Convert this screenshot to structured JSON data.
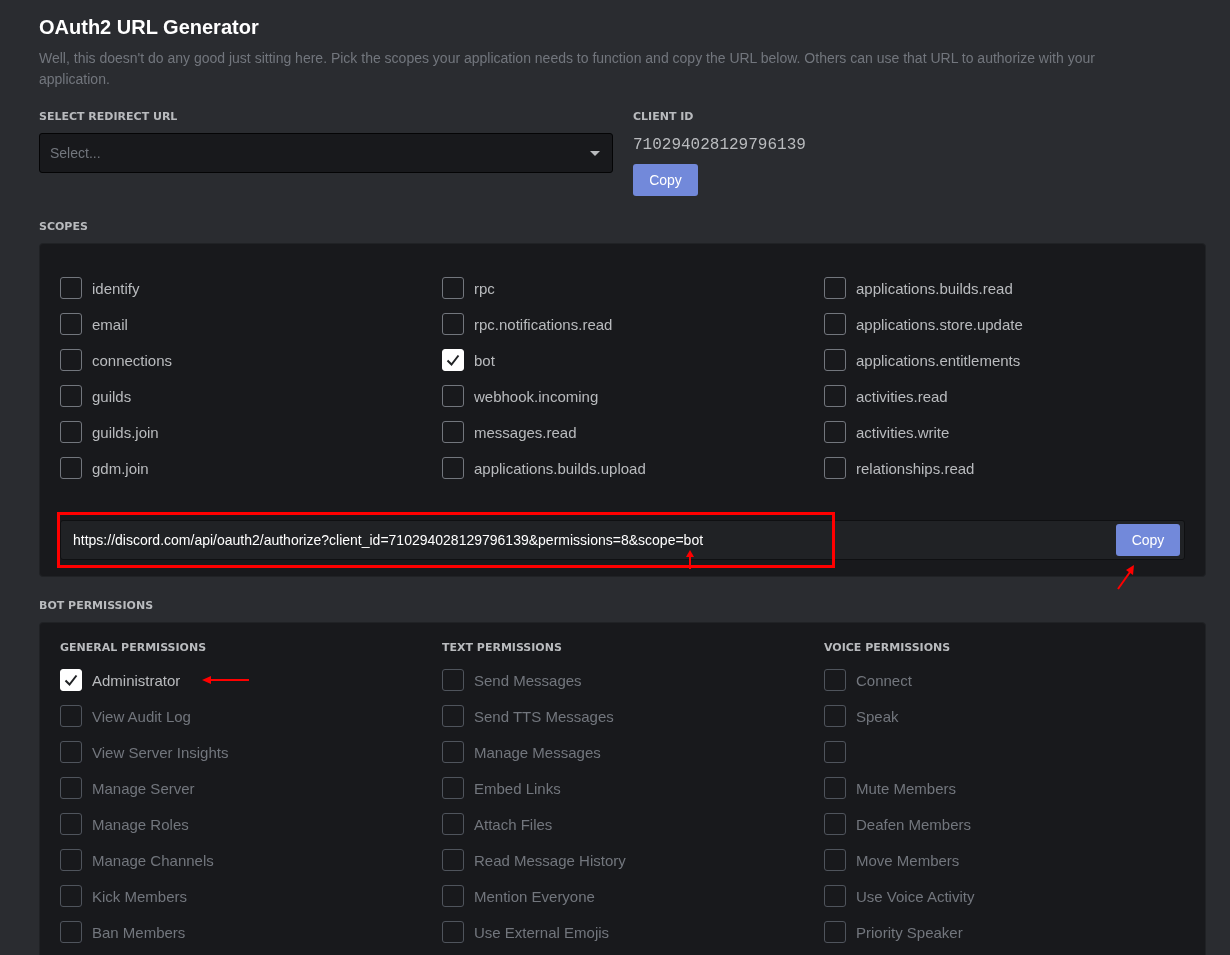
{
  "title": "OAuth2 URL Generator",
  "description": "Well, this doesn't do any good just sitting here. Pick the scopes your application needs to function and copy the URL below. Others can use that URL to authorize with your application.",
  "redirect": {
    "label": "SELECT REDIRECT URL",
    "placeholder": "Select..."
  },
  "client_id": {
    "label": "CLIENT ID",
    "value": "710294028129796139",
    "button": "Copy"
  },
  "scopes": {
    "label": "SCOPES",
    "items": [
      {
        "label": "identify",
        "checked": false
      },
      {
        "label": "rpc",
        "checked": false
      },
      {
        "label": "applications.builds.read",
        "checked": false
      },
      {
        "label": "email",
        "checked": false
      },
      {
        "label": "rpc.notifications.read",
        "checked": false
      },
      {
        "label": "applications.store.update",
        "checked": false
      },
      {
        "label": "connections",
        "checked": false
      },
      {
        "label": "bot",
        "checked": true
      },
      {
        "label": "applications.entitlements",
        "checked": false
      },
      {
        "label": "guilds",
        "checked": false
      },
      {
        "label": "webhook.incoming",
        "checked": false
      },
      {
        "label": "activities.read",
        "checked": false
      },
      {
        "label": "guilds.join",
        "checked": false
      },
      {
        "label": "messages.read",
        "checked": false
      },
      {
        "label": "activities.write",
        "checked": false
      },
      {
        "label": "gdm.join",
        "checked": false
      },
      {
        "label": "applications.builds.upload",
        "checked": false
      },
      {
        "label": "relationships.read",
        "checked": false
      }
    ],
    "url": "https://discord.com/api/oauth2/authorize?client_id=710294028129796139&permissions=8&scope=bot",
    "button": "Copy"
  },
  "bot_permissions": {
    "label": "BOT PERMISSIONS",
    "groups": [
      {
        "title": "GENERAL PERMISSIONS",
        "items": [
          {
            "label": "Administrator",
            "checked": true,
            "disabled": false
          },
          {
            "label": "View Audit Log",
            "checked": false,
            "disabled": true
          },
          {
            "label": "View Server Insights",
            "checked": false,
            "disabled": true
          },
          {
            "label": "Manage Server",
            "checked": false,
            "disabled": true
          },
          {
            "label": "Manage Roles",
            "checked": false,
            "disabled": true
          },
          {
            "label": "Manage Channels",
            "checked": false,
            "disabled": true
          },
          {
            "label": "Kick Members",
            "checked": false,
            "disabled": true
          },
          {
            "label": "Ban Members",
            "checked": false,
            "disabled": true
          }
        ]
      },
      {
        "title": "TEXT PERMISSIONS",
        "items": [
          {
            "label": "Send Messages",
            "checked": false,
            "disabled": true
          },
          {
            "label": "Send TTS Messages",
            "checked": false,
            "disabled": true
          },
          {
            "label": "Manage Messages",
            "checked": false,
            "disabled": true
          },
          {
            "label": "Embed Links",
            "checked": false,
            "disabled": true
          },
          {
            "label": "Attach Files",
            "checked": false,
            "disabled": true
          },
          {
            "label": "Read Message History",
            "checked": false,
            "disabled": true
          },
          {
            "label": "Mention Everyone",
            "checked": false,
            "disabled": true
          },
          {
            "label": "Use External Emojis",
            "checked": false,
            "disabled": true
          }
        ]
      },
      {
        "title": "VOICE PERMISSIONS",
        "items": [
          {
            "label": "Connect",
            "checked": false,
            "disabled": true
          },
          {
            "label": "Speak",
            "checked": false,
            "disabled": true
          },
          {
            "checked": false,
            "disabled": true
          },
          {
            "label": "Mute Members",
            "checked": false,
            "disabled": true
          },
          {
            "label": "Deafen Members",
            "checked": false,
            "disabled": true
          },
          {
            "label": "Move Members",
            "checked": false,
            "disabled": true
          },
          {
            "label": "Use Voice Activity",
            "checked": false,
            "disabled": true
          },
          {
            "label": "Priority Speaker",
            "checked": false,
            "disabled": true
          }
        ]
      }
    ]
  }
}
